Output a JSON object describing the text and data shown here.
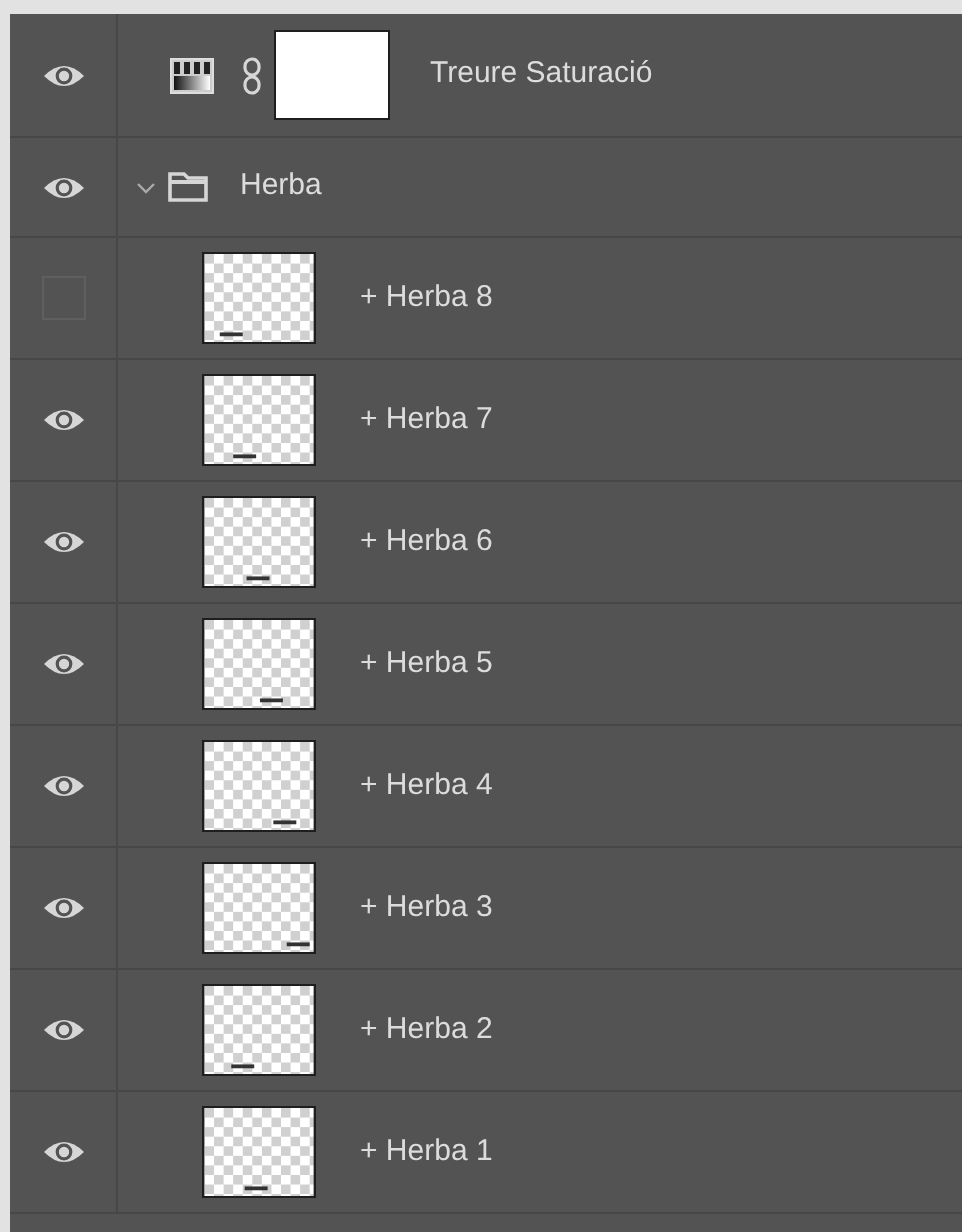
{
  "layers": [
    {
      "kind": "adjustment",
      "name": "Treure Saturació",
      "visible": true
    },
    {
      "kind": "group",
      "name": "Herba",
      "visible": true,
      "expanded": true,
      "children": [
        {
          "kind": "pixel",
          "name": "+ Herba 8",
          "visible": false
        },
        {
          "kind": "pixel",
          "name": "+ Herba 7",
          "visible": true
        },
        {
          "kind": "pixel",
          "name": "+ Herba 6",
          "visible": true
        },
        {
          "kind": "pixel",
          "name": "+ Herba 5",
          "visible": true
        },
        {
          "kind": "pixel",
          "name": "+ Herba 4",
          "visible": true
        },
        {
          "kind": "pixel",
          "name": "+ Herba 3",
          "visible": true
        },
        {
          "kind": "pixel",
          "name": "+ Herba 2",
          "visible": true
        },
        {
          "kind": "pixel",
          "name": "+ Herba 1",
          "visible": true
        }
      ]
    }
  ]
}
